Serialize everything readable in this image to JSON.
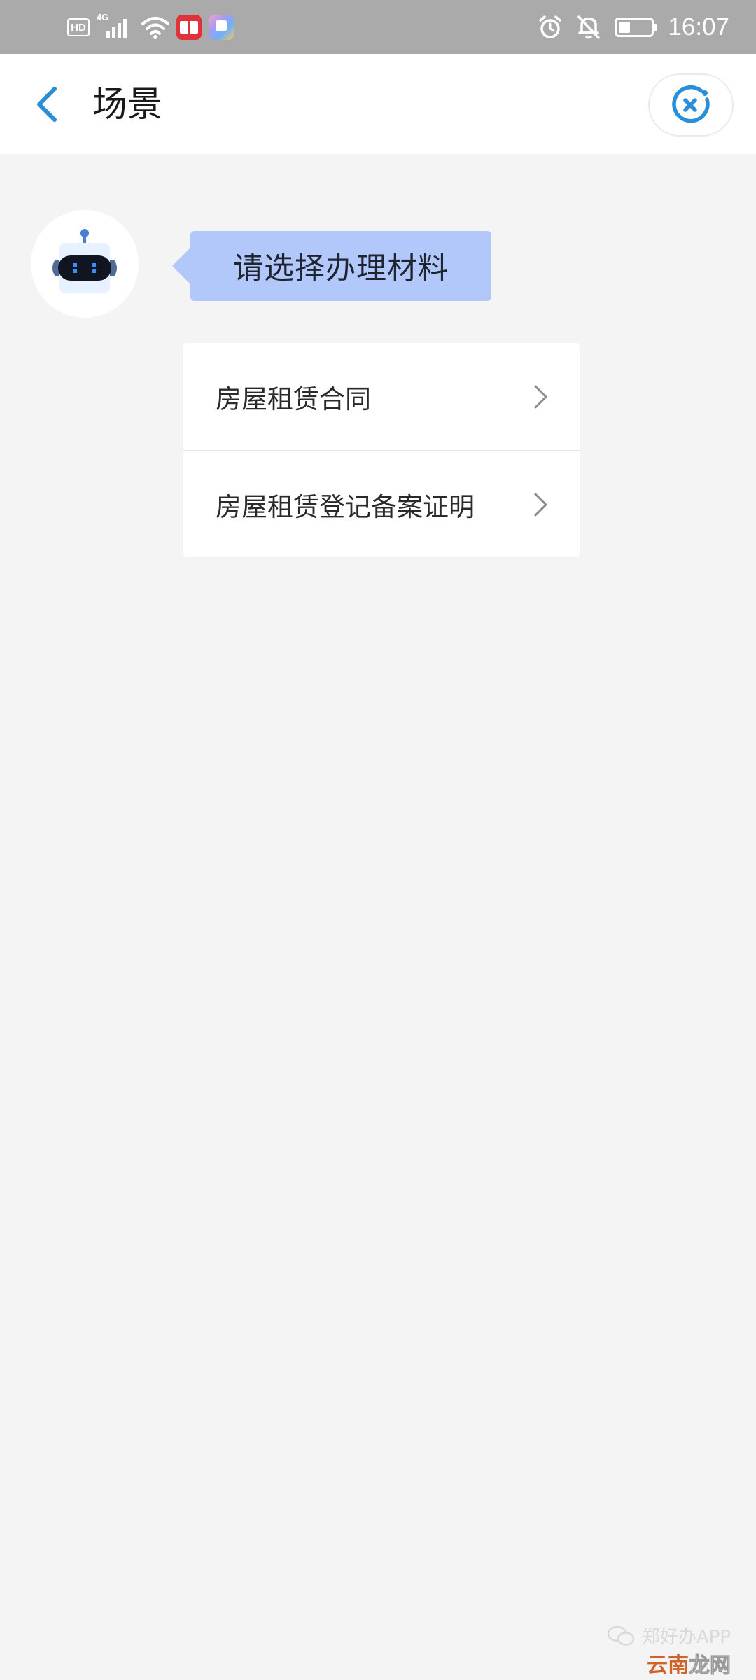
{
  "status_bar": {
    "hd_label": "HD",
    "network_label": "4G",
    "time": "16:07",
    "icons": [
      "hd-icon",
      "signal-icon",
      "wifi-icon",
      "book-app-icon",
      "colorful-app-icon",
      "alarm-icon",
      "mute-bell-icon",
      "battery-icon"
    ]
  },
  "header": {
    "title": "场景",
    "back_icon": "chevron-left-icon",
    "close_icon": "close-circle-icon",
    "accent_color": "#2a8fd6"
  },
  "chat": {
    "avatar_icon": "robot-icon",
    "bot_message": "请选择办理材料",
    "bubble_color": "#b2c8fb"
  },
  "options": [
    {
      "label": "房屋租赁合同"
    },
    {
      "label": "房屋租赁登记备案证明"
    }
  ],
  "watermark": {
    "source": "郑好办APP",
    "site_part_a": "云南",
    "site_part_b": "龙网"
  }
}
